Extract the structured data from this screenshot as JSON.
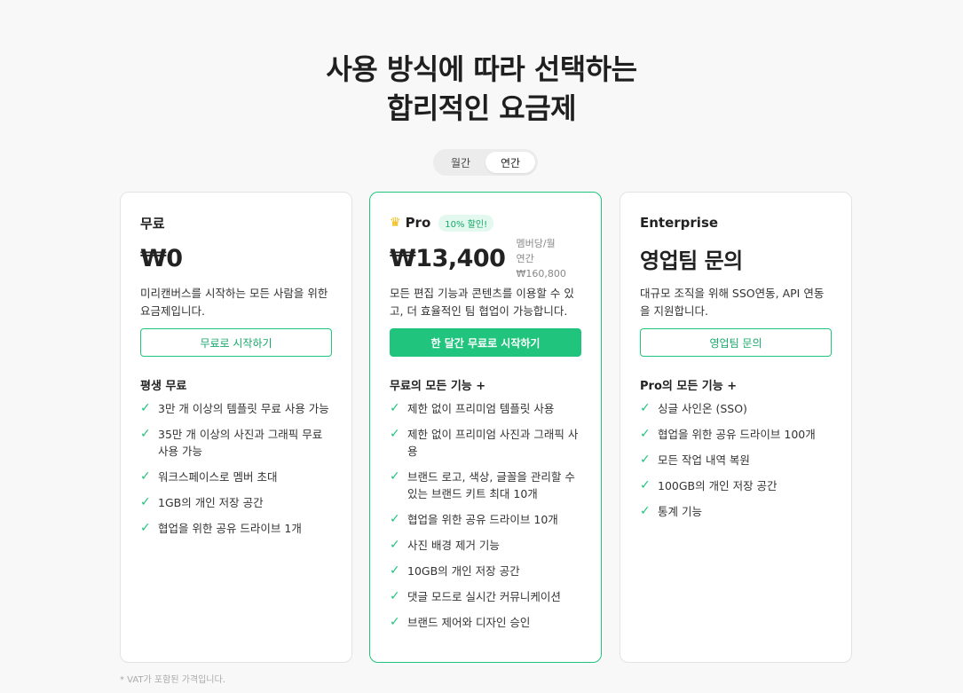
{
  "heading": {
    "line1": "사용 방식에 따라 선택하는",
    "line2": "합리적인 요금제"
  },
  "billing_toggle": {
    "monthly": "월간",
    "yearly": "연간",
    "selected": "연간"
  },
  "plans": [
    {
      "title": "무료",
      "price": "₩0",
      "description": "미리캔버스를 시작하는 모든 사람을 위한 요금제입니다.",
      "cta": "무료로 시작하기",
      "features_title": "평생 무료",
      "features": [
        "3만 개 이상의 템플릿 무료 사용 가능",
        "35만 개 이상의 사진과 그래픽 무료 사용 가능",
        "워크스페이스로 멤버 초대",
        "1GB의 개인 저장 공간",
        "협업을 위한 공유 드라이브 1개"
      ]
    },
    {
      "title": "Pro",
      "badge": "10% 할인!",
      "price": "₩13,400",
      "price_unit": "멤버당/월",
      "price_annual": "연간 ₩160,800",
      "description": "모든 편집 기능과 콘텐츠를 이용할 수 있고, 더 효율적인 팀 협업이 가능합니다.",
      "cta": "한 달간 무료로 시작하기",
      "features_title": "무료의 모든 기능 +",
      "features": [
        "제한 없이 프리미엄 템플릿 사용",
        "제한 없이 프리미엄 사진과 그래픽 사용",
        "브랜드 로고, 색상, 글꼴을 관리할 수 있는 브랜드 키트 최대 10개",
        "협업을 위한 공유 드라이브 10개",
        "사진 배경 제거 기능",
        "10GB의 개인 저장 공간",
        "댓글 모드로 실시간 커뮤니케이션",
        "브랜드 제어와 디자인 승인"
      ]
    },
    {
      "title": "Enterprise",
      "price": "영업팀 문의",
      "description": "대규모 조직을 위해 SSO연동, API 연동을 지원합니다.",
      "cta": "영업팀 문의",
      "features_title": "Pro의 모든 기능 +",
      "features": [
        "싱글 사인온 (SSO)",
        "협업을 위한 공유 드라이브 100개",
        "모든 작업 내역 복원",
        "100GB의 개인 저장 공간",
        "통계 기능"
      ]
    }
  ],
  "footnote": "* VAT가 포함된 가격입니다.",
  "colors": {
    "accent": "#21c47d",
    "accent_text": "#17a86a",
    "crown": "#f2b705"
  }
}
